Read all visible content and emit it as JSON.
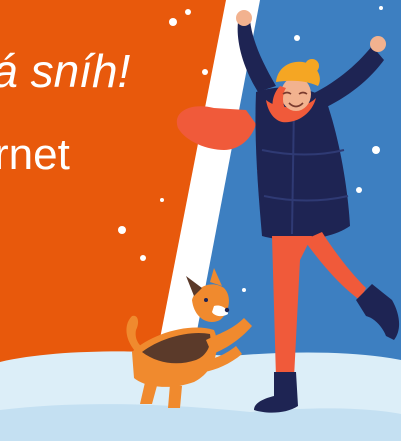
{
  "banner": {
    "headline": "lá sníh!",
    "subline": "rnet"
  },
  "colors": {
    "orange_panel": "#e8590c",
    "blue_panel": "#3d7fc1",
    "snow": "#dceef8",
    "coat": "#1e2453",
    "leggings": "#f05a3a",
    "hat": "#f5a623",
    "dog": "#f08a2e"
  },
  "icons": [
    "snowflake-icon",
    "woman-figure",
    "dog-figure"
  ]
}
